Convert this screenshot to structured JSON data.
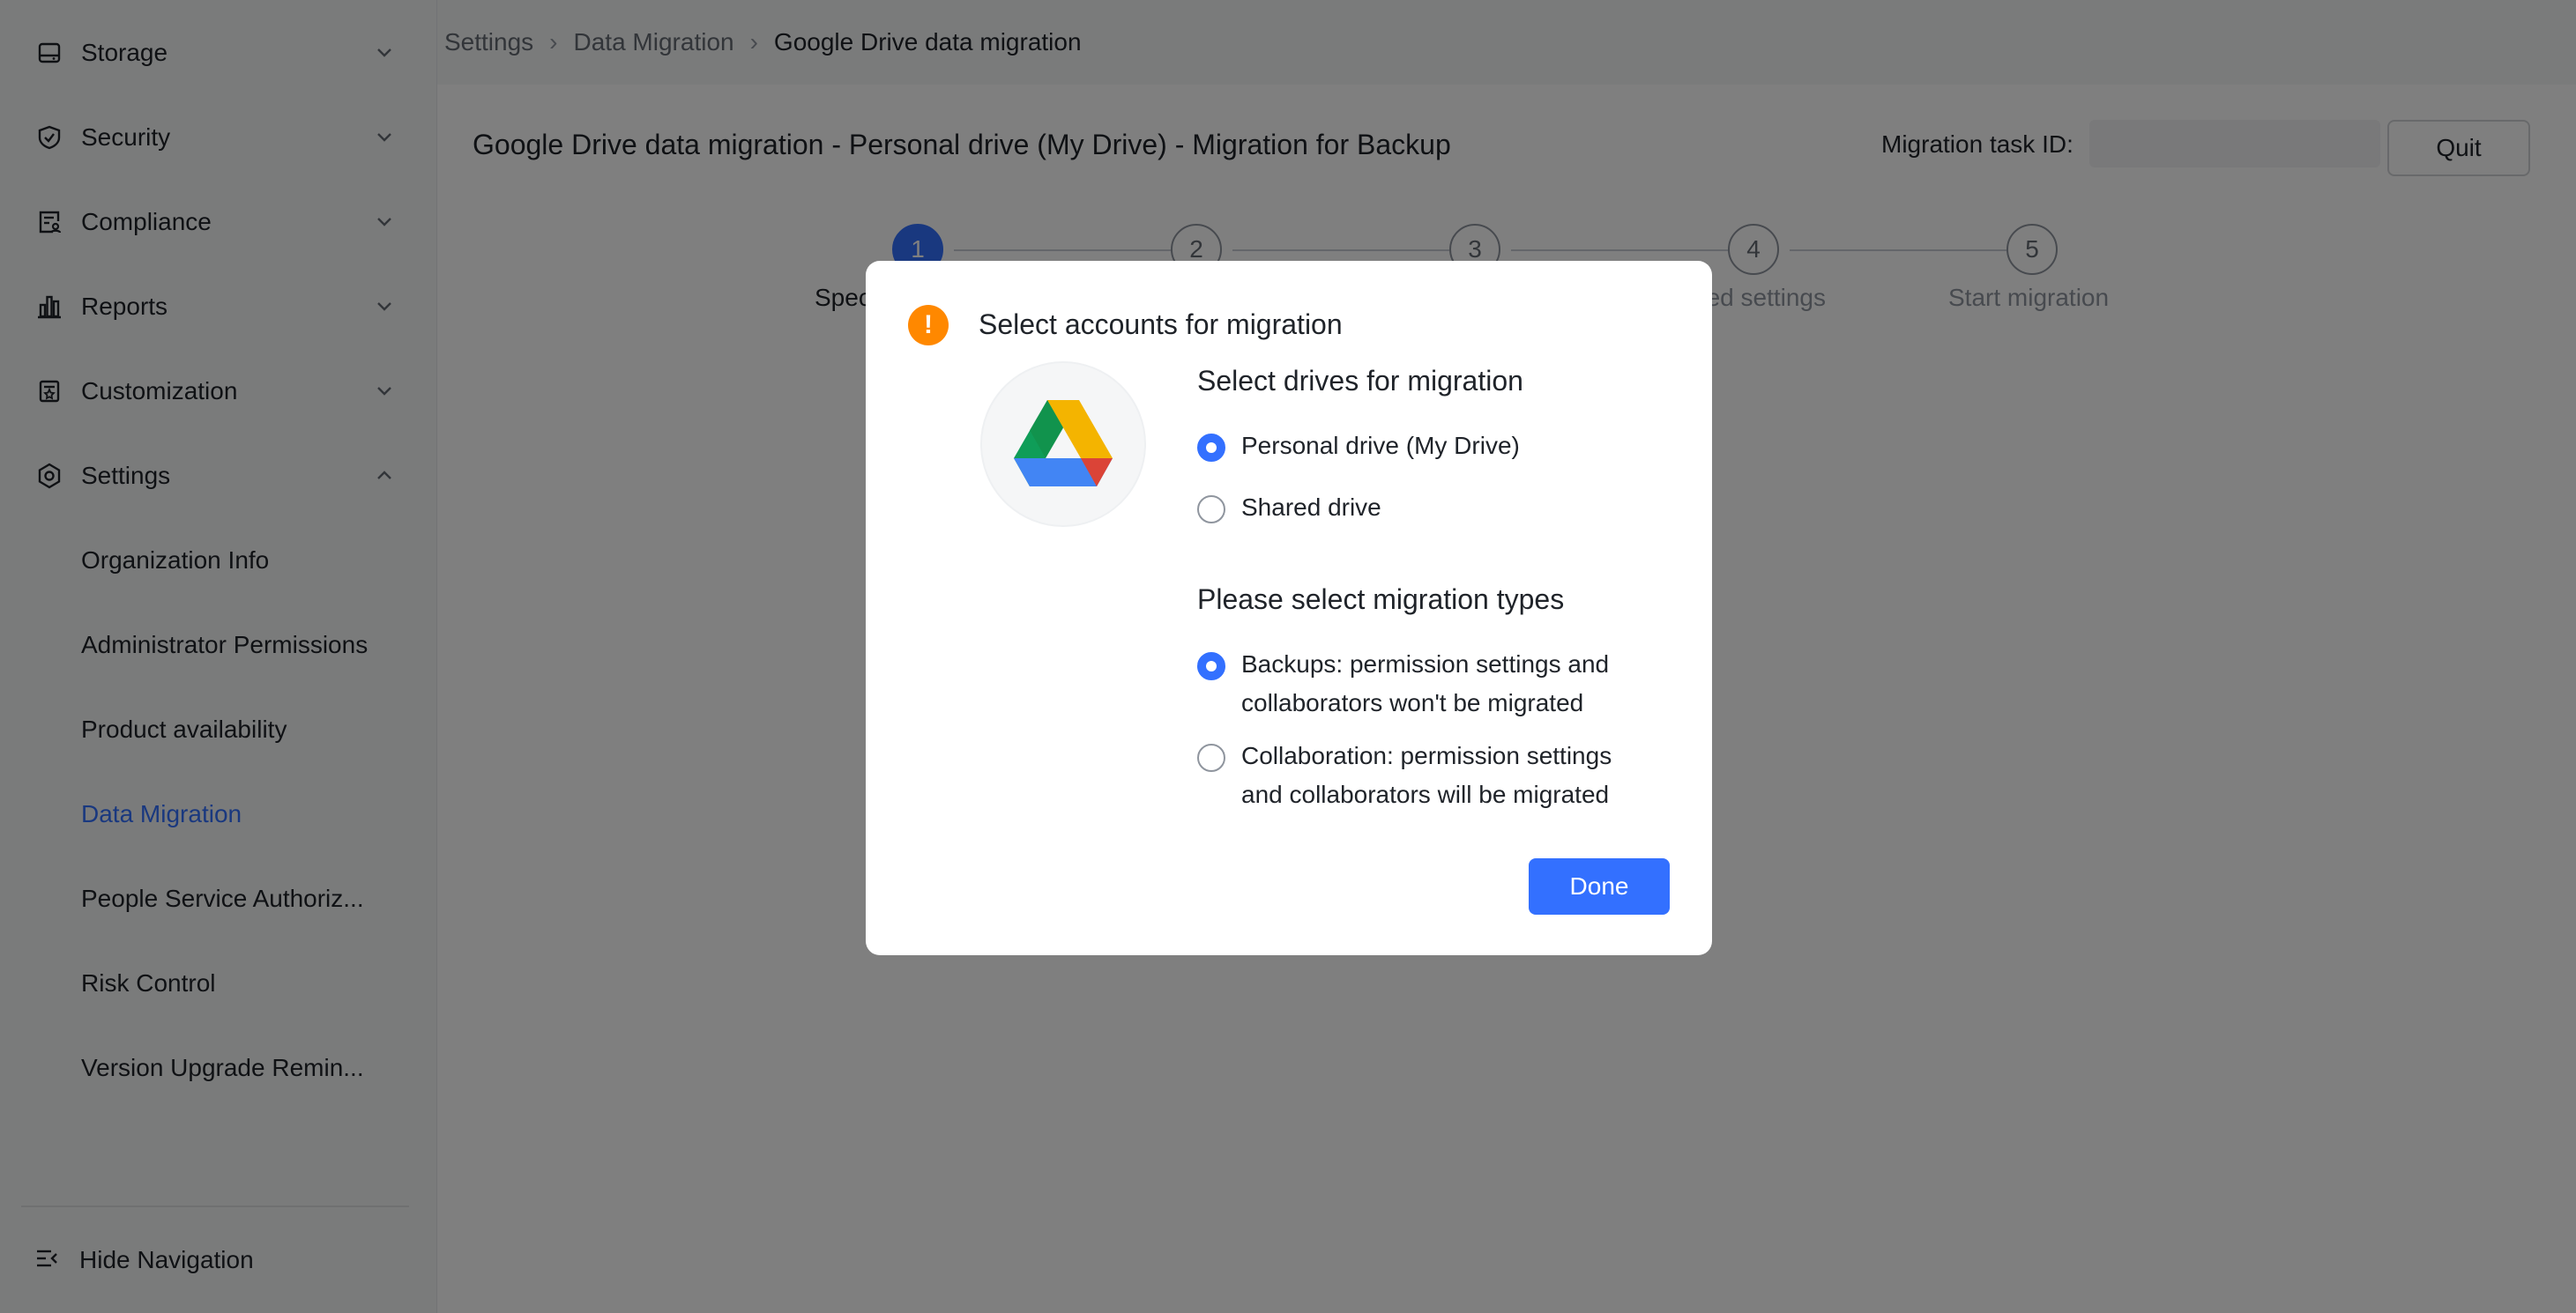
{
  "sidebar": {
    "items": [
      {
        "label": "Storage",
        "icon": "hard-drive-icon"
      },
      {
        "label": "Security",
        "icon": "shield-icon"
      },
      {
        "label": "Compliance",
        "icon": "compliance-document-icon"
      },
      {
        "label": "Reports",
        "icon": "bar-chart-icon"
      },
      {
        "label": "Customization",
        "icon": "customization-icon"
      },
      {
        "label": "Settings",
        "icon": "settings-gear-icon"
      }
    ],
    "settings_subitems": [
      "Organization Info",
      "Administrator Permissions",
      "Product availability",
      "Data Migration",
      "People Service Authoriz...",
      "Risk Control",
      "Version Upgrade Remin..."
    ],
    "active_subitem": "Data Migration",
    "hide_navigation_label": "Hide Navigation"
  },
  "breadcrumb": [
    "Settings",
    "Data Migration",
    "Google Drive data migration"
  ],
  "page": {
    "title": "Google Drive data migration - Personal drive (My Drive) - Migration for Backup",
    "task_id_label": "Migration task ID:",
    "task_id_value": "",
    "quit_label": "Quit"
  },
  "steps": [
    {
      "number": "1",
      "label": "Spec"
    },
    {
      "number": "2",
      "label": ""
    },
    {
      "number": "3",
      "label": ""
    },
    {
      "number": "4",
      "label": "nced settings"
    },
    {
      "number": "5",
      "label": "Start migration"
    }
  ],
  "modal": {
    "title": "Select accounts for migration",
    "warning_icon": "!",
    "drives_section_title": "Select drives for migration",
    "drive_options": [
      {
        "label": "Personal drive (My Drive)",
        "selected": true
      },
      {
        "label": "Shared drive",
        "selected": false
      }
    ],
    "types_section_title": "Please select migration types",
    "type_options": [
      {
        "line1": "Backups: permission settings and",
        "line2": "collaborators won't be migrated",
        "selected": true
      },
      {
        "line1": "Collaboration: permission settings",
        "line2": "and collaborators will be migrated",
        "selected": false
      }
    ],
    "done_label": "Done"
  },
  "colors": {
    "accent": "#3370ff",
    "warning": "#ff8800",
    "overlay": "rgba(0,0,0,0.5)"
  }
}
